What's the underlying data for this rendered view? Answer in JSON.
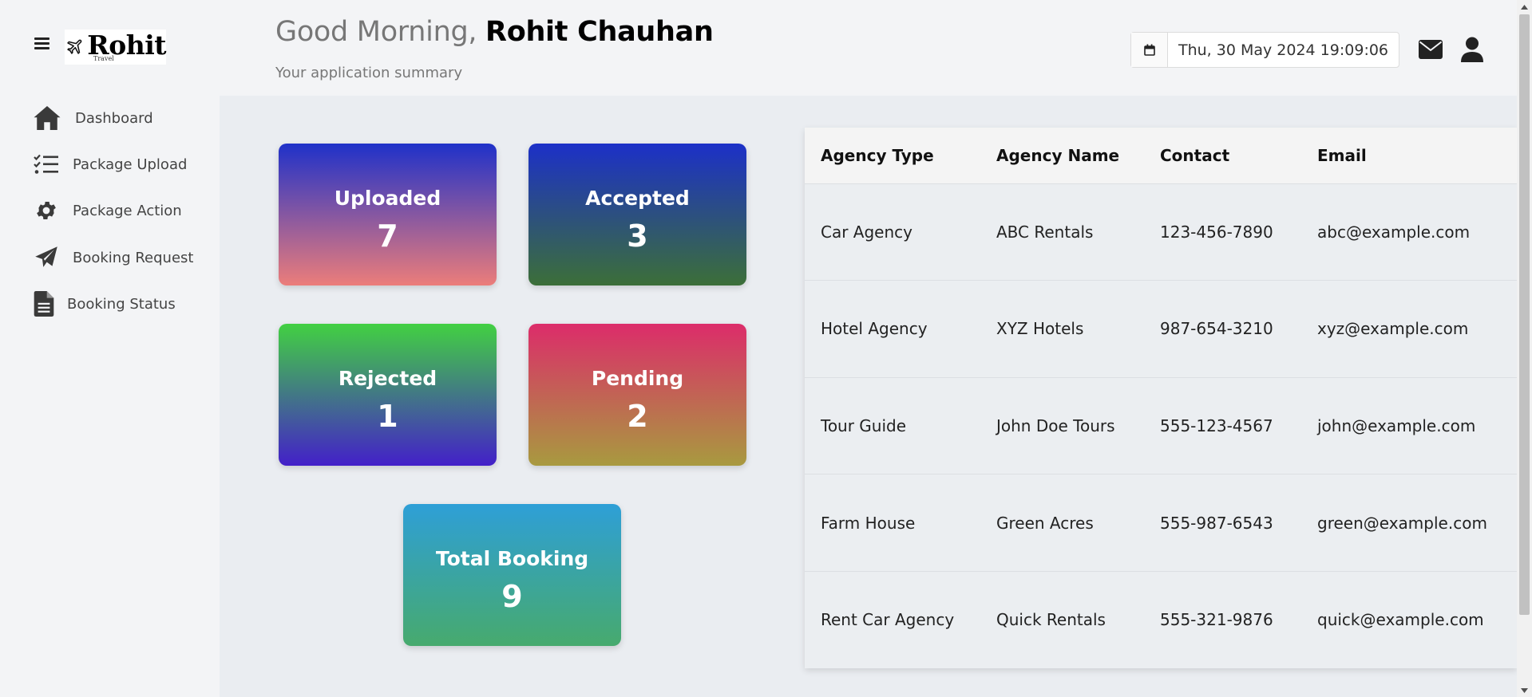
{
  "app": {
    "logo_text": "Rohit",
    "logo_subtext": "Travel"
  },
  "sidebar": {
    "items": [
      {
        "label": "Dashboard",
        "icon": "home-icon"
      },
      {
        "label": "Package Upload",
        "icon": "checklist-icon"
      },
      {
        "label": "Package Action",
        "icon": "gear-icon"
      },
      {
        "label": "Booking Request",
        "icon": "paper-plane-icon"
      },
      {
        "label": "Booking Status",
        "icon": "document-icon"
      }
    ]
  },
  "header": {
    "greeting_prefix": "Good Morning, ",
    "user_name": "Rohit Chauhan",
    "subtitle": "Your application summary",
    "datetime": "Thu, 30 May 2024 19:09:06"
  },
  "stats": {
    "uploaded": {
      "label": "Uploaded",
      "value": "7"
    },
    "accepted": {
      "label": "Accepted",
      "value": "3"
    },
    "rejected": {
      "label": "Rejected",
      "value": "1"
    },
    "pending": {
      "label": "Pending",
      "value": "2"
    },
    "total": {
      "label": "Total Booking",
      "value": "9"
    }
  },
  "table": {
    "headers": [
      "Agency Type",
      "Agency Name",
      "Contact",
      "Email"
    ],
    "rows": [
      [
        "Car Agency",
        "ABC Rentals",
        "123-456-7890",
        "abc@example.com"
      ],
      [
        "Hotel Agency",
        "XYZ Hotels",
        "987-654-3210",
        "xyz@example.com"
      ],
      [
        "Tour Guide",
        "John Doe Tours",
        "555-123-4567",
        "john@example.com"
      ],
      [
        "Farm House",
        "Green Acres",
        "555-987-6543",
        "green@example.com"
      ],
      [
        "Rent Car Agency",
        "Quick Rentals",
        "555-321-9876",
        "quick@example.com"
      ]
    ]
  },
  "colors": {
    "uploaded_gradient": [
      "#1f31c9",
      "#ec7d7a"
    ],
    "accepted_gradient": [
      "#1c30c8",
      "#3c6f38"
    ],
    "rejected_gradient": [
      "#42d042",
      "#4320c9"
    ],
    "pending_gradient": [
      "#dc2c6a",
      "#a89a3f"
    ],
    "total_gradient": [
      "#2e9fd7",
      "#47aa6d"
    ]
  }
}
